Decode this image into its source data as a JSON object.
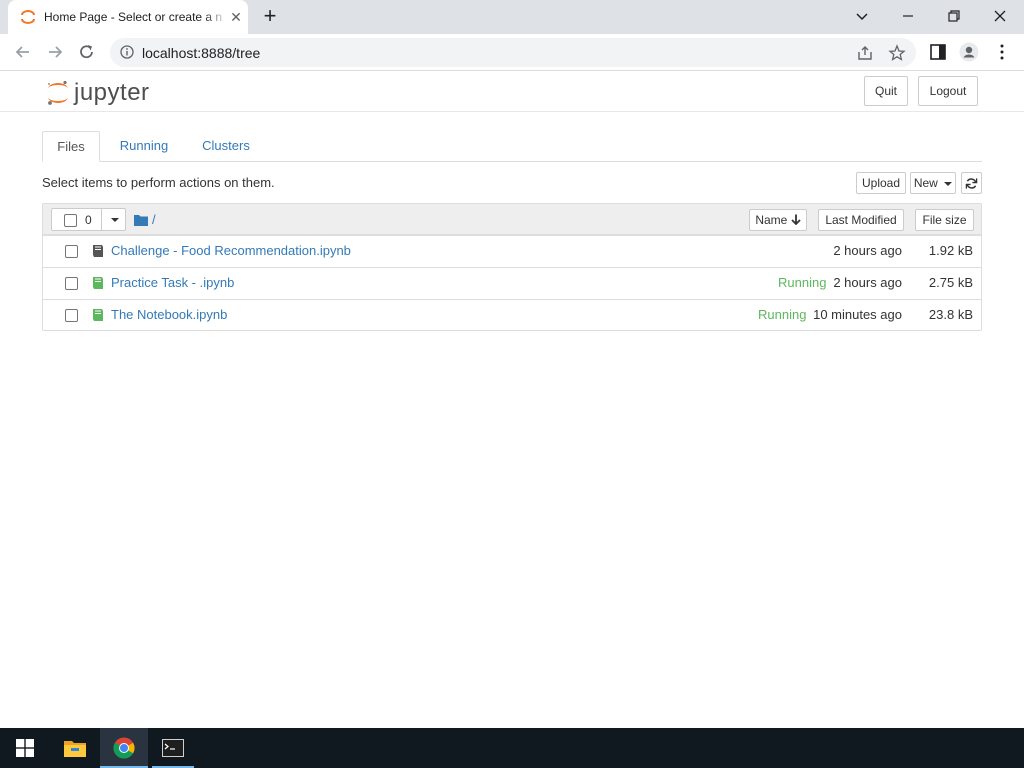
{
  "browser": {
    "tab_title": "Home Page - Select or create a n",
    "url": "localhost:8888/tree"
  },
  "header": {
    "logo_text": "jupyter",
    "quit_label": "Quit",
    "logout_label": "Logout"
  },
  "tabs": [
    {
      "label": "Files",
      "active": true
    },
    {
      "label": "Running",
      "active": false
    },
    {
      "label": "Clusters",
      "active": false
    }
  ],
  "toolbar": {
    "instruction": "Select items to perform actions on them.",
    "upload_label": "Upload",
    "new_label": "New",
    "refresh_icon": "refresh-icon"
  },
  "list_header": {
    "selected_count": "0",
    "breadcrumb": "/",
    "sort_name": "Name",
    "sort_modified": "Last Modified",
    "sort_size": "File size"
  },
  "files": [
    {
      "name": "Challenge - Food Recommendation.ipynb",
      "running": "",
      "modified": "2 hours ago",
      "size": "1.92 kB",
      "icon_color": "#555555"
    },
    {
      "name": "Practice Task - .ipynb",
      "running": "Running",
      "modified": "2 hours ago",
      "size": "2.75 kB",
      "icon_color": "#5cb85c"
    },
    {
      "name": "The Notebook.ipynb",
      "running": "Running",
      "modified": "10 minutes ago",
      "size": "23.8 kB",
      "icon_color": "#5cb85c"
    }
  ],
  "colors": {
    "link": "#337ab7",
    "running": "#5cb85c",
    "jupyter_orange": "#f37726"
  }
}
